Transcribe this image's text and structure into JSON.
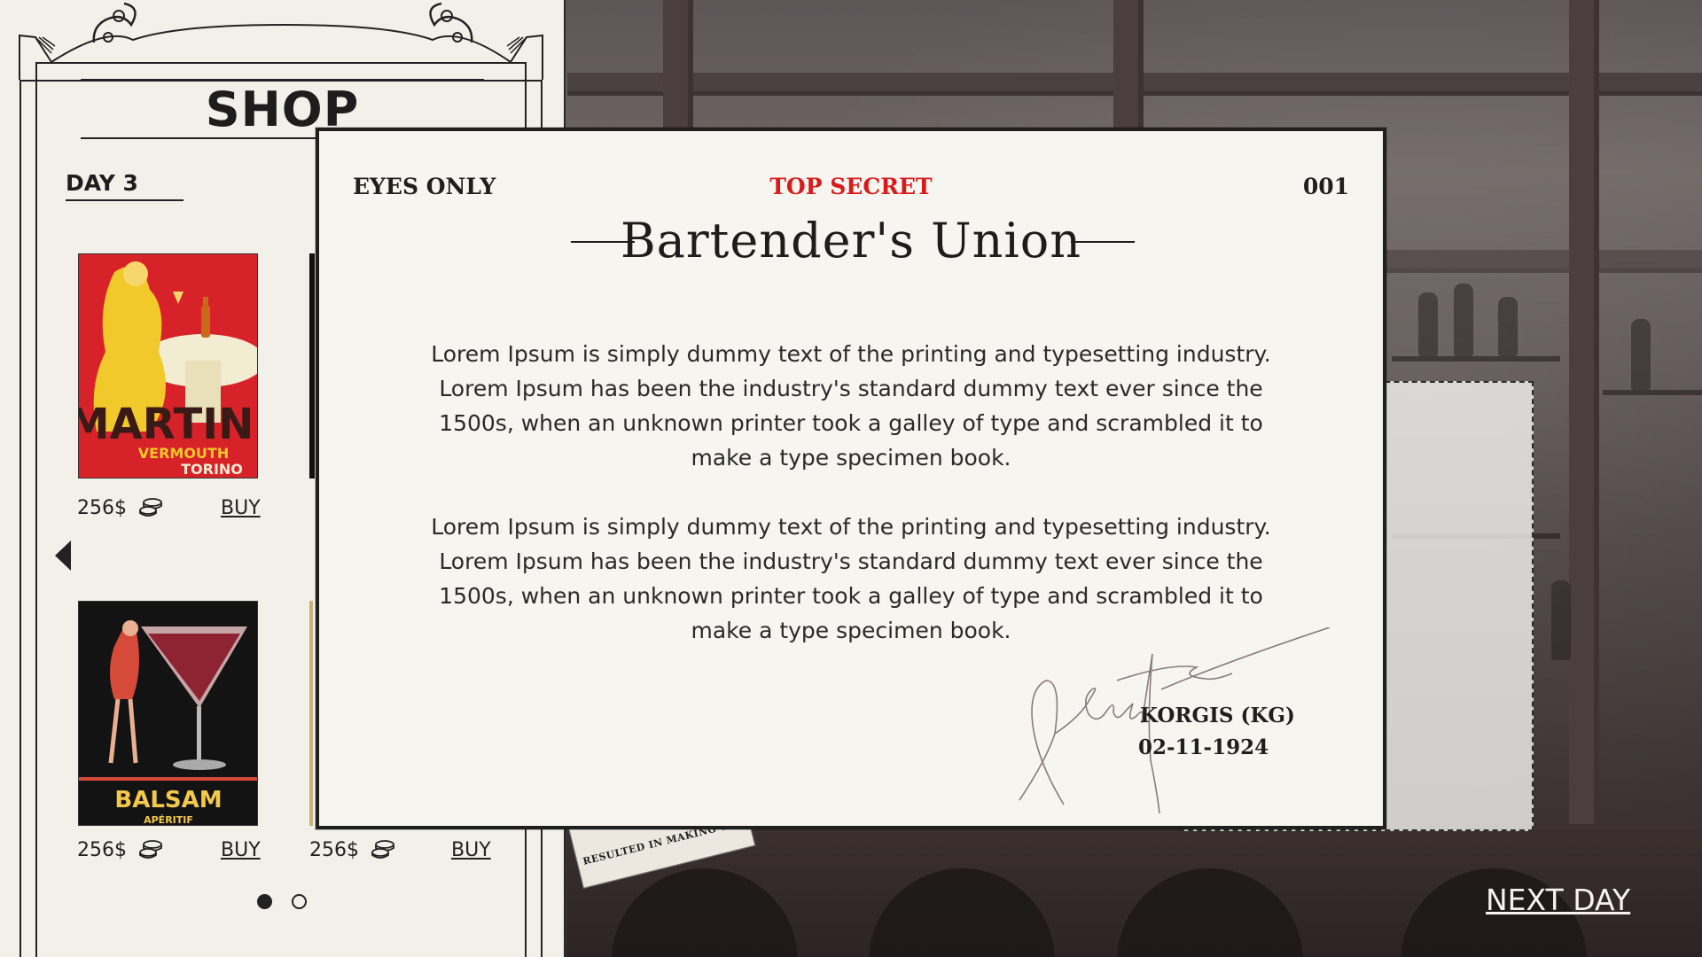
{
  "shop": {
    "title": "SHOP",
    "day": "DAY 3",
    "items": [
      {
        "poster_name": "martini-poster",
        "poster_text": "MARTINI",
        "poster_sub1": "VERMOUTH",
        "poster_sub2": "TORINO",
        "price": "256$",
        "buy_label": "BUY"
      },
      {
        "poster_name": "balsam-poster",
        "poster_text": "BALSAM",
        "poster_sub1": "APÉRITIF",
        "price": "256$",
        "buy_label": "BUY"
      },
      {
        "poster_name": "hidden-poster",
        "price": "256$",
        "buy_label": "BUY"
      }
    ],
    "pagination": {
      "pages": 2,
      "current": 1
    }
  },
  "document": {
    "eyes_only": "EYES ONLY",
    "top_secret": "TOP SECRET",
    "number": "001",
    "title": "Bartender's Union",
    "paragraphs": [
      "Lorem Ipsum is simply dummy text of the printing and typesetting industry. Lorem Ipsum has been the industry's standard dummy text ever since the 1500s, when an unknown printer took a galley of type and scrambled it to make a type specimen book.",
      "Lorem Ipsum is simply dummy text of the printing and typesetting industry. Lorem Ipsum has been the industry's standard dummy text ever since the 1500s, when an unknown printer took a galley of type and scrambled it to make a type specimen book."
    ],
    "signatory": "KORGIS (KG)",
    "date": "02-11-1924"
  },
  "newspaper": {
    "headline": "RESULTED IN MAKING THE NATION DRY"
  },
  "next_day": "NEXT DAY",
  "colors": {
    "top_secret": "#d81a1a",
    "paper": "#f7f5f0",
    "panel": "#f3f0ea",
    "ink": "#1f1f1f"
  }
}
